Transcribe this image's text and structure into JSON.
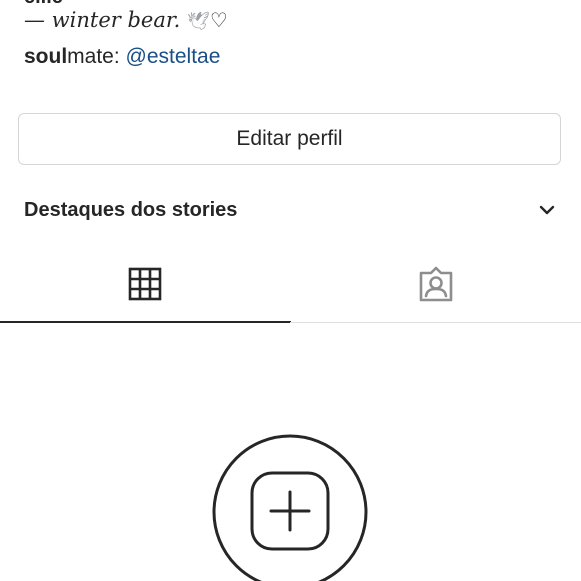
{
  "profile": {
    "name_cut": "ellie",
    "bio_line": "— winter bear.",
    "bio_emoji_dove": "🕊",
    "bio_emoji_heart": "♡",
    "soulmate_bold": "soul",
    "soulmate_rest": "mate: ",
    "soulmate_mention": "@esteltae"
  },
  "actions": {
    "edit_profile_label": "Editar perfil"
  },
  "highlights": {
    "label": "Destaques dos stories",
    "icon": "chevron-down-icon"
  },
  "tabs": [
    {
      "icon": "grid-icon",
      "active": true
    },
    {
      "icon": "tagged-icon",
      "active": false
    }
  ],
  "empty_state": {
    "icon": "add-post-icon"
  },
  "colors": {
    "text": "#262626",
    "mention": "#1a4f86",
    "border": "#d6d6d6",
    "icon_inactive": "#8e8e8e"
  }
}
